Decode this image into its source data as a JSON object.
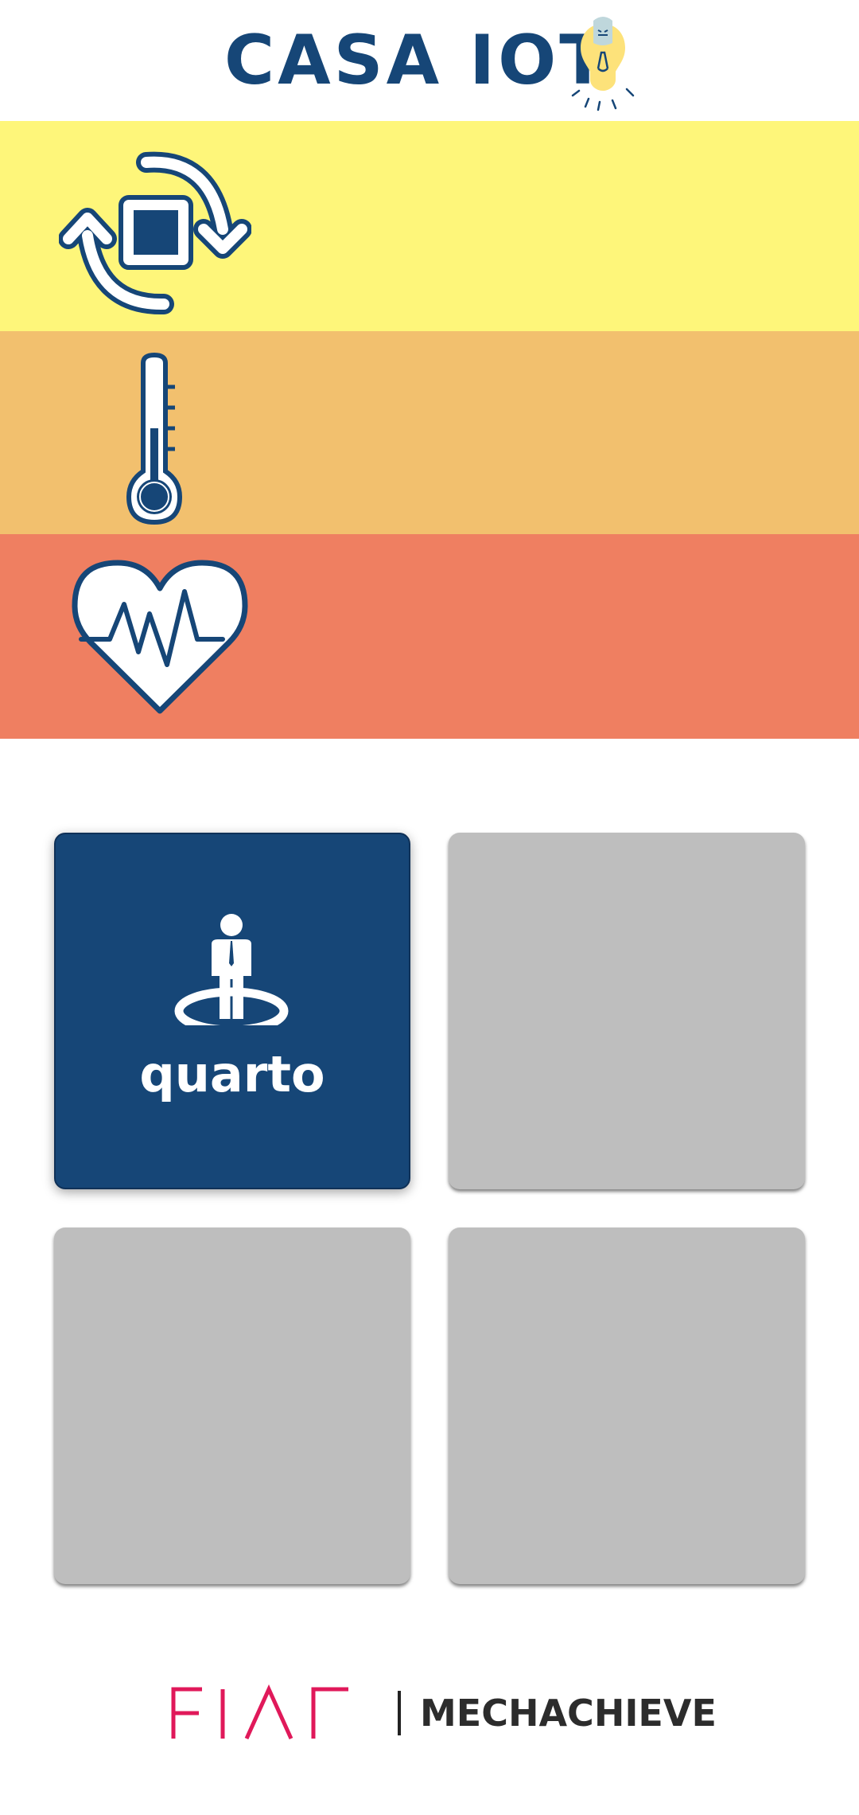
{
  "header": {
    "title": "CASA IOT",
    "icon": "lightbulb-icon"
  },
  "status_bands": [
    {
      "icon": "sync-icon",
      "color": "#fef67a"
    },
    {
      "icon": "thermometer-icon",
      "color": "#f2c06e"
    },
    {
      "icon": "heart-pulse-icon",
      "color": "#ef7f61"
    }
  ],
  "rooms": {
    "tiles": [
      {
        "label": "quarto",
        "icon": "person-location-icon",
        "state": "active",
        "color": "#164677"
      },
      {
        "label": "",
        "state": "inactive",
        "color": "#bebebe"
      },
      {
        "label": "",
        "state": "inactive",
        "color": "#bebebe"
      },
      {
        "label": "",
        "state": "inactive",
        "color": "#bebebe"
      }
    ]
  },
  "footer": {
    "logo_text": "FIAP",
    "brand": "MECHACHIEVE",
    "logo_color": "#e0195a"
  },
  "colors": {
    "primary": "#164677",
    "white": "#ffffff"
  }
}
